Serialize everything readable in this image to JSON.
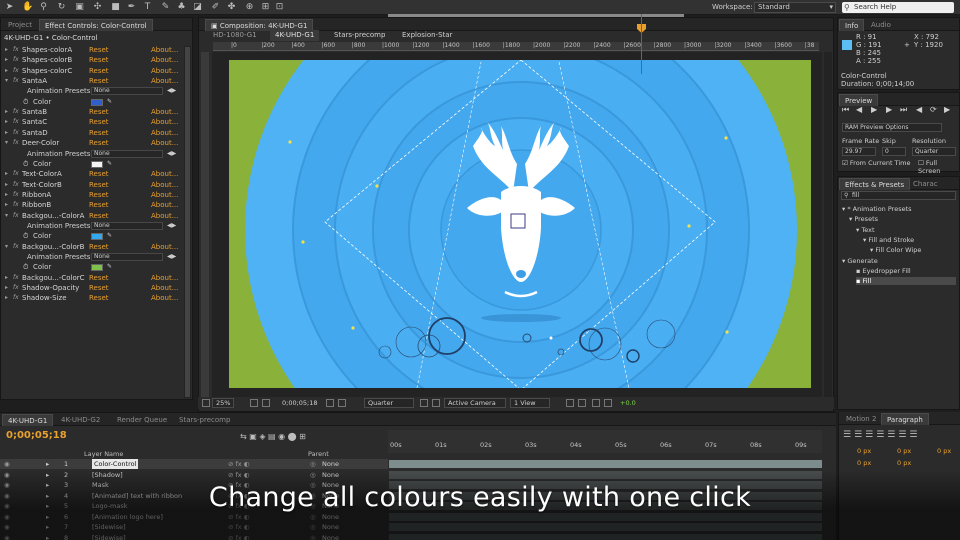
{
  "toolbar": {
    "workspace_label": "Workspace:",
    "workspace_value": "Standard",
    "search_placeholder": "Search Help"
  },
  "left_panel": {
    "tabs": [
      "Project",
      "Effect Controls: Color-Control"
    ],
    "header": "4K-UHD-G1 • Color-Control",
    "reset_label": "Reset",
    "about_label": "About...",
    "presets_label": "Animation Presets:",
    "presets_value": "None",
    "color_label": "Color",
    "rows": [
      {
        "kind": "effect",
        "name": "Shapes-colorA",
        "expanded": false
      },
      {
        "kind": "effect",
        "name": "Shapes-colorB",
        "expanded": false
      },
      {
        "kind": "effect",
        "name": "Shapes-colorC",
        "expanded": false
      },
      {
        "kind": "effect",
        "name": "SantaA",
        "expanded": true
      },
      {
        "kind": "presets"
      },
      {
        "kind": "color",
        "swatch": "#2f5fcf"
      },
      {
        "kind": "effect",
        "name": "SantaB",
        "expanded": false
      },
      {
        "kind": "effect",
        "name": "SantaC",
        "expanded": false
      },
      {
        "kind": "effect",
        "name": "SantaD",
        "expanded": false
      },
      {
        "kind": "effect",
        "name": "Deer-Color",
        "expanded": true
      },
      {
        "kind": "presets"
      },
      {
        "kind": "color",
        "swatch": "#f4f4f4"
      },
      {
        "kind": "effect",
        "name": "Text-ColorA",
        "expanded": false
      },
      {
        "kind": "effect",
        "name": "Text-ColorB",
        "expanded": false
      },
      {
        "kind": "effect",
        "name": "RibbonA",
        "expanded": false
      },
      {
        "kind": "effect",
        "name": "RibbonB",
        "expanded": false
      },
      {
        "kind": "effect",
        "name": "Backgou...-ColorA",
        "expanded": true
      },
      {
        "kind": "presets"
      },
      {
        "kind": "color",
        "swatch": "#33a8f0"
      },
      {
        "kind": "effect",
        "name": "Backgou...-ColorB",
        "expanded": true
      },
      {
        "kind": "presets"
      },
      {
        "kind": "color",
        "swatch": "#7ec24a"
      },
      {
        "kind": "effect",
        "name": "Backgou...-ColorC",
        "expanded": false
      },
      {
        "kind": "effect",
        "name": "Shadow-Opacity",
        "expanded": false
      },
      {
        "kind": "effect",
        "name": "Shadow-Size",
        "expanded": false
      }
    ]
  },
  "composition": {
    "tab": "Composition: 4K-UHD-G1",
    "crumbs": [
      "HD-1080-G1",
      "4K-UHD-G1",
      "Stars-precomp",
      "Explosion-Star"
    ],
    "ruler_ticks": [
      "0",
      "200",
      "400",
      "600",
      "800",
      "1000",
      "1200",
      "1400",
      "1600",
      "1800",
      "2000",
      "2200",
      "2400",
      "2600",
      "2800",
      "3000",
      "3200",
      "3400",
      "3600",
      "38"
    ],
    "zoom": "25%",
    "timecode": "0;00;05;18",
    "resolution": "Quarter",
    "camera": "Active Camera",
    "view": "1 View",
    "exposure": "+0.0",
    "colors": {
      "outer": "#8ab13a",
      "ring_light": "#4fb2f4",
      "ring_dark": "#3c9ee6",
      "deer": "#ffffff"
    }
  },
  "info_panel": {
    "tabs": [
      "Info",
      "Audio"
    ],
    "r": "R : 91",
    "g": "G : 191",
    "b": "B : 245",
    "a": "A : 255",
    "x": "X : 792",
    "y": "Y : 1920",
    "swatch": "#5bbff5",
    "layer": "Color-Control",
    "duration": "Duration: 0;00;14;00"
  },
  "preview_panel": {
    "tab": "Preview",
    "ram_options": "RAM Preview Options",
    "frame_rate_label": "Frame Rate",
    "skip_label": "Skip",
    "resolution_label": "Resolution",
    "frame_rate": "29.97",
    "skip": "0",
    "resolution": "Quarter",
    "from_current": "From Current Time",
    "full_screen": "Full Screen"
  },
  "effects_panel": {
    "tabs": [
      "Effects & Presets",
      "Charac"
    ],
    "search_value": "fill",
    "tree": [
      {
        "indent": 0,
        "label": "* Animation Presets"
      },
      {
        "indent": 1,
        "label": "Presets"
      },
      {
        "indent": 2,
        "label": "Text"
      },
      {
        "indent": 3,
        "label": "Fill and Stroke"
      },
      {
        "indent": 4,
        "label": "Fill Color Wipe"
      },
      {
        "indent": 0,
        "label": "Generate"
      },
      {
        "indent": 2,
        "label": "Eyedropper Fill"
      },
      {
        "indent": 2,
        "label": "Fill",
        "selected": true
      }
    ]
  },
  "timeline": {
    "tabs": [
      "4K-UHD-G1",
      "4K-UHD-G2",
      "Render Queue",
      "Stars-precomp"
    ],
    "time": "0;00;05;18",
    "ruler": [
      "00s",
      "01s",
      "02s",
      "03s",
      "04s",
      "05s",
      "06s",
      "07s",
      "08s",
      "09s"
    ],
    "layer_name_header": "Layer Name",
    "parent_header": "Parent",
    "parent_value": "None",
    "layers": [
      {
        "num": "1",
        "name": "Color-Control"
      },
      {
        "num": "2",
        "name": "[Shadow]"
      },
      {
        "num": "3",
        "name": "Mask"
      },
      {
        "num": "4",
        "name": "[Animated] text with ribbon"
      },
      {
        "num": "5",
        "name": "Logo-mask"
      },
      {
        "num": "6",
        "name": "[Animation logo here]"
      },
      {
        "num": "7",
        "name": "[Sidewise]"
      },
      {
        "num": "8",
        "name": "[Sidewise]"
      }
    ]
  },
  "right_bottom": {
    "tabs": [
      "Motion 2",
      "Paragraph"
    ],
    "px": "0 px"
  },
  "caption": "Change all colours easily with one click"
}
